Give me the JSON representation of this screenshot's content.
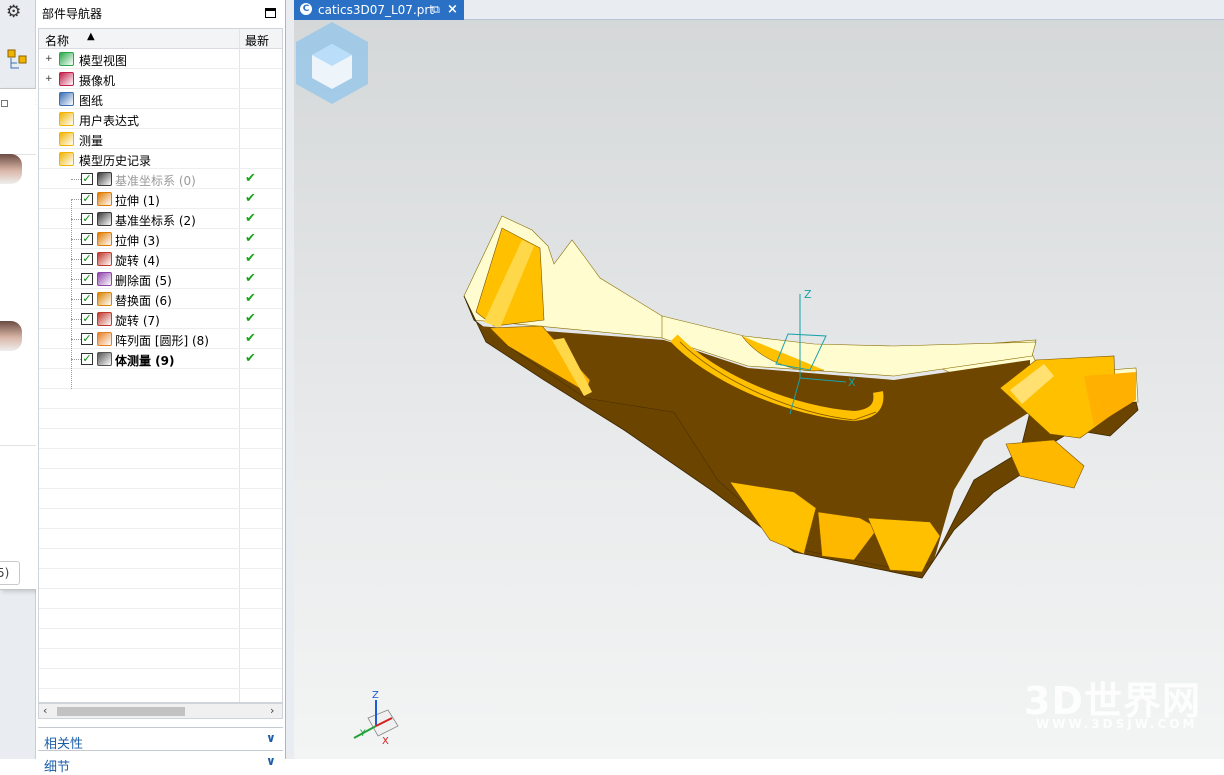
{
  "navigator": {
    "title": "部件导航器",
    "col_name": "名称",
    "col_latest": "最新",
    "tree": [
      {
        "label": "模型视图",
        "level": 0,
        "expand": "+",
        "icon": "model-view-icon",
        "latest": ""
      },
      {
        "label": "摄像机",
        "level": 0,
        "expand": "+",
        "icon": "camera-icon",
        "latest": ""
      },
      {
        "label": "图纸",
        "level": 0,
        "expand": "",
        "icon": "drawing-icon",
        "latest": ""
      },
      {
        "label": "用户表达式",
        "level": 0,
        "expand": "",
        "icon": "folder-icon",
        "latest": ""
      },
      {
        "label": "测量",
        "level": 0,
        "expand": "",
        "icon": "folder-icon",
        "latest": ""
      },
      {
        "label": "模型历史记录",
        "level": 0,
        "expand": "",
        "icon": "open-folder-icon",
        "latest": ""
      },
      {
        "label": "基准坐标系 (0)",
        "level": 1,
        "icon": "datum-csys-icon",
        "latest": "✔",
        "dim": true
      },
      {
        "label": "拉伸 (1)",
        "level": 1,
        "icon": "extrude-icon",
        "latest": "✔"
      },
      {
        "label": "基准坐标系 (2)",
        "level": 1,
        "icon": "datum-csys-icon",
        "latest": "✔"
      },
      {
        "label": "拉伸 (3)",
        "level": 1,
        "icon": "extrude-icon",
        "latest": "✔"
      },
      {
        "label": "旋转 (4)",
        "level": 1,
        "icon": "revolve-icon",
        "latest": "✔"
      },
      {
        "label": "删除面 (5)",
        "level": 1,
        "icon": "delete-face-icon",
        "latest": "✔"
      },
      {
        "label": "替换面 (6)",
        "level": 1,
        "icon": "replace-face-icon",
        "latest": "✔"
      },
      {
        "label": "旋转 (7)",
        "level": 1,
        "icon": "revolve-icon",
        "latest": "✔"
      },
      {
        "label": "阵列面 [圆形] (8)",
        "level": 1,
        "icon": "pattern-face-icon",
        "latest": "✔"
      },
      {
        "label": "体测量 (9)",
        "level": 1,
        "icon": "measure-body-icon",
        "latest": "✔",
        "bold": true
      }
    ],
    "panel_dependencies": "相关性",
    "panel_details": "细节"
  },
  "tab": {
    "label": "catics3D07_L07.prt"
  },
  "viewport": {
    "triad": {
      "x": "X",
      "y": "Y",
      "z": "Z"
    },
    "watermark": {
      "brand": "3D世界网",
      "url": "WWW.3DSJW.COM"
    }
  },
  "popup": {
    "button_fragment": "5)"
  },
  "colors": {
    "accent": "#2a71c6",
    "part_dark": "#6b4500",
    "part_face": "#ffc000",
    "part_top": "#fffdd0"
  }
}
